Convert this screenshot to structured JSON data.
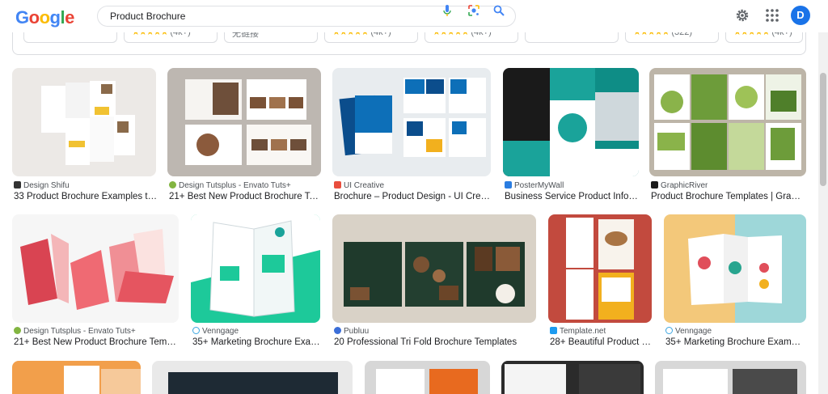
{
  "search": {
    "query": "Product Brochure"
  },
  "user": {
    "initial": "D"
  },
  "colors": {
    "brand_blue": "#4285f4",
    "avatar": "#1a73e8"
  },
  "chips": [
    {
      "text": ""
    },
    {
      "text": "(4k+)"
    },
    {
      "text": "无链接"
    },
    {
      "text": "(4k+)"
    },
    {
      "text": "(4k+)"
    },
    {
      "text": ""
    },
    {
      "text": "(322)"
    },
    {
      "text": "(4k+)"
    }
  ],
  "row1": [
    {
      "source": "Design Shifu",
      "title": "33 Product Brochure Examples to ..."
    },
    {
      "source": "Design Tutsplus - Envato Tuts+",
      "title": "21+ Best New Product Brochure Te..."
    },
    {
      "source": "UI Creative",
      "title": "Brochure – Product Design - UI Creati..."
    },
    {
      "source": "PosterMyWall",
      "title": "Business Service Product Infor..."
    },
    {
      "source": "GraphicRiver",
      "title": "Product Brochure Templates | Graphi..."
    }
  ],
  "row2": [
    {
      "source": "Design Tutsplus - Envato Tuts+",
      "title": "21+ Best New Product Brochure Templa..."
    },
    {
      "source": "Venngage",
      "title": "35+ Marketing Brochure Exam..."
    },
    {
      "source": "Publuu",
      "title": "20 Professional Tri Fold Brochure Templates"
    },
    {
      "source": "Template.net",
      "title": "28+ Beautiful Product B..."
    },
    {
      "source": "Venngage",
      "title": "35+ Marketing Brochure Example..."
    }
  ]
}
